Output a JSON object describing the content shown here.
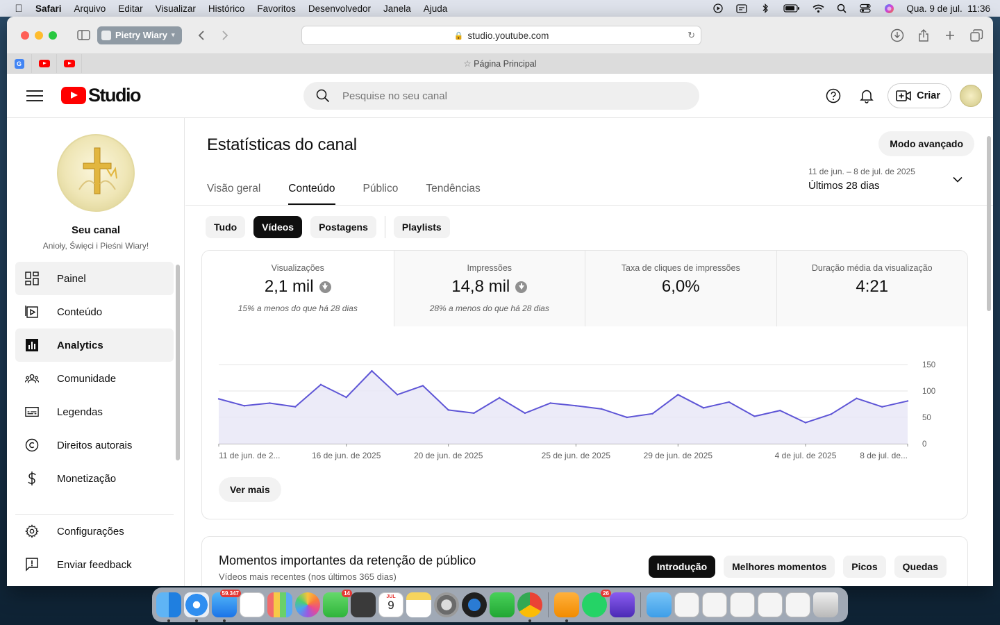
{
  "menubar": {
    "app": "Safari",
    "items": [
      "Arquivo",
      "Editar",
      "Visualizar",
      "Histórico",
      "Favoritos",
      "Desenvolvedor",
      "Janela",
      "Ajuda"
    ],
    "datetime": "Qua. 9 de jul.  11:36"
  },
  "browser": {
    "profile": "Pietry Wiary",
    "url": "studio.youtube.com",
    "tab_title": "Página Principal"
  },
  "header": {
    "logo_text": "Studio",
    "search_placeholder": "Pesquise no seu canal",
    "create_label": "Criar"
  },
  "sidebar": {
    "channel_label": "Seu canal",
    "channel_name": "Anioły, Święci i Pieśni Wiary!",
    "items": [
      {
        "label": "Painel",
        "icon": "dashboard-icon"
      },
      {
        "label": "Conteúdo",
        "icon": "content-icon"
      },
      {
        "label": "Analytics",
        "icon": "analytics-icon"
      },
      {
        "label": "Comunidade",
        "icon": "community-icon"
      },
      {
        "label": "Legendas",
        "icon": "subtitles-icon"
      },
      {
        "label": "Direitos autorais",
        "icon": "copyright-icon"
      },
      {
        "label": "Monetização",
        "icon": "monetization-icon"
      }
    ],
    "bottom_items": [
      {
        "label": "Configurações",
        "icon": "gear-icon"
      },
      {
        "label": "Enviar feedback",
        "icon": "feedback-icon"
      }
    ]
  },
  "main": {
    "title": "Estatísticas do canal",
    "advanced_label": "Modo avançado",
    "tabs": [
      "Visão geral",
      "Conteúdo",
      "Público",
      "Tendências"
    ],
    "active_tab": "Conteúdo",
    "date_range": {
      "sub": "11 de jun. – 8 de jul. de 2025",
      "main": "Últimos 28 dias"
    },
    "chips": [
      "Tudo",
      "Vídeos",
      "Postagens",
      "Playlists"
    ],
    "active_chip": "Vídeos",
    "metrics": [
      {
        "label": "Visualizações",
        "value": "2,1 mil",
        "note": "15% a menos do que há 28 dias",
        "arrow": true
      },
      {
        "label": "Impressões",
        "value": "14,8 mil",
        "note": "28% a menos do que há 28 dias",
        "arrow": true
      },
      {
        "label": "Taxa de cliques de impressões",
        "value": "6,0%",
        "note": "",
        "arrow": false
      },
      {
        "label": "Duração média da visualização",
        "value": "4:21",
        "note": "",
        "arrow": false
      }
    ],
    "see_more": "Ver mais",
    "retention": {
      "title": "Momentos importantes da retenção de público",
      "subtitle": "Vídeos mais recentes (nos últimos 365 dias)",
      "chips": [
        "Introdução",
        "Melhores momentos",
        "Picos",
        "Quedas"
      ],
      "active_chip": "Introdução"
    }
  },
  "chart_data": {
    "type": "area",
    "x": [
      "11 jun",
      "12 jun",
      "13 jun",
      "14 jun",
      "15 jun",
      "16 jun",
      "17 jun",
      "18 jun",
      "19 jun",
      "20 jun",
      "21 jun",
      "22 jun",
      "23 jun",
      "24 jun",
      "25 jun",
      "26 jun",
      "27 jun",
      "28 jun",
      "29 jun",
      "30 jun",
      "1 jul",
      "2 jul",
      "3 jul",
      "4 jul",
      "5 jul",
      "6 jul",
      "7 jul",
      "8 jul"
    ],
    "values": [
      85,
      72,
      77,
      70,
      112,
      88,
      138,
      93,
      110,
      64,
      58,
      87,
      58,
      77,
      72,
      66,
      50,
      57,
      93,
      68,
      79,
      52,
      63,
      40,
      56,
      86,
      70,
      81
    ],
    "tick_labels": [
      {
        "index": 0,
        "label": "11 de jun. de 2..."
      },
      {
        "index": 5,
        "label": "16 de jun. de 2025"
      },
      {
        "index": 9,
        "label": "20 de jun. de 2025"
      },
      {
        "index": 14,
        "label": "25 de jun. de 2025"
      },
      {
        "index": 18,
        "label": "29 de jun. de 2025"
      },
      {
        "index": 23,
        "label": "4 de jul. de 2025"
      },
      {
        "index": 27,
        "label": "8 de jul. de..."
      }
    ],
    "yticks": [
      0,
      50,
      100,
      150
    ],
    "ylim": [
      0,
      150
    ],
    "line_color": "#5e55d6",
    "fill_color": "#e9e7f7",
    "grid": true
  },
  "dock": {
    "mail_badge": "59.347",
    "facetime_badge": "14",
    "whatsapp_badge": "26",
    "calendar_month": "JUL",
    "calendar_day": "9"
  }
}
